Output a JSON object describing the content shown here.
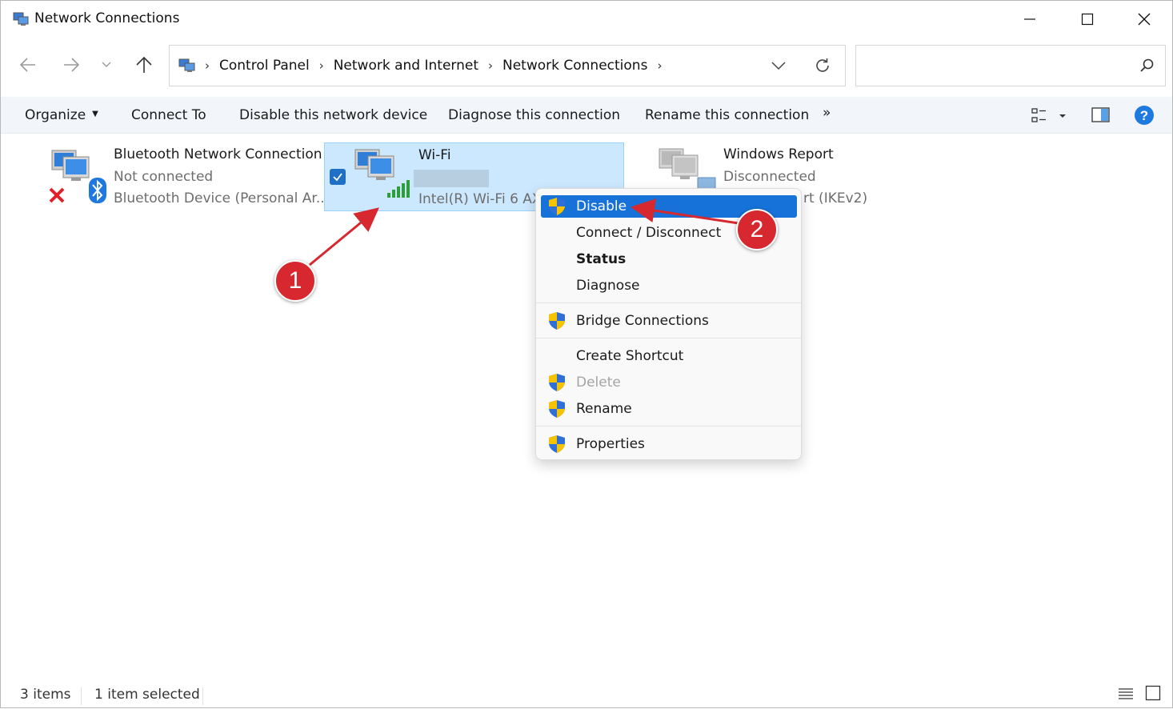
{
  "window": {
    "title": "Network Connections"
  },
  "address": {
    "crumbs": [
      "Control Panel",
      "Network and Internet",
      "Network Connections"
    ],
    "search_placeholder": ""
  },
  "commands": {
    "organize": "Organize",
    "connect_to": "Connect To",
    "disable_device": "Disable this network device",
    "diagnose": "Diagnose this connection",
    "rename": "Rename this connection",
    "more": "»"
  },
  "connections": [
    {
      "name": "Bluetooth Network Connection",
      "status": "Not connected",
      "device": "Bluetooth Device (Personal Ar..."
    },
    {
      "name": "Wi-Fi",
      "status": "",
      "device": "Intel(R) Wi-Fi 6 AX"
    },
    {
      "name": "Windows Report",
      "status": "Disconnected",
      "device": "rt (IKEv2)"
    }
  ],
  "context_menu": {
    "items": [
      {
        "label": "Disable",
        "shield": true,
        "highlighted": true
      },
      {
        "label": "Connect / Disconnect"
      },
      {
        "label": "Status",
        "bold": true
      },
      {
        "label": "Diagnose"
      },
      {
        "label": "Bridge Connections",
        "shield": true
      },
      {
        "label": "Create Shortcut"
      },
      {
        "label": "Delete",
        "shield": true,
        "disabled": true
      },
      {
        "label": "Rename",
        "shield": true
      },
      {
        "label": "Properties",
        "shield": true
      }
    ]
  },
  "annotations": {
    "step1": "1",
    "step2": "2"
  },
  "status_bar": {
    "count": "3 items",
    "selected": "1 item selected"
  },
  "colors": {
    "selection_bg": "#cce8ff",
    "menu_highlight": "#1672d8",
    "annotation": "#d6282e"
  }
}
